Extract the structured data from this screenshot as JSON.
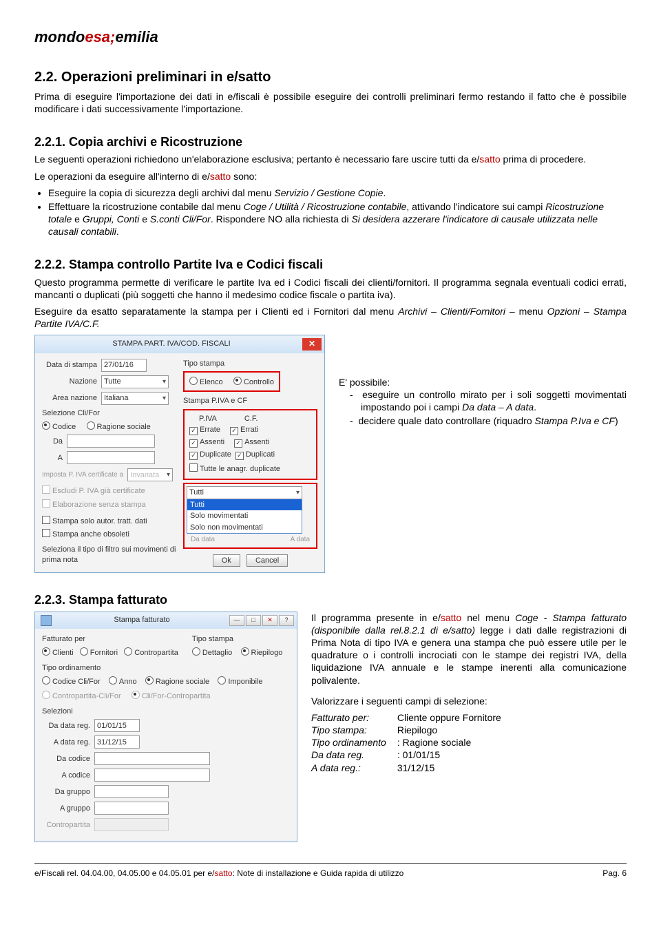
{
  "brand": {
    "part1": "mondo",
    "part2": "esa;",
    "part3": "emilia"
  },
  "s22": {
    "title": "2.2. Operazioni preliminari in e/satto",
    "p1a": "Prima di eseguire l'importazione dei dati in e/fiscali è possibile eseguire dei controlli preliminari fermo restando il fatto che è possibile modificare i dati successivamente l'importazione."
  },
  "s221": {
    "title": "2.2.1. Copia archivi e Ricostruzione",
    "p1a": "Le seguenti operazioni richiedono un'elaborazione esclusiva; pertanto è necessario fare uscire tutti da e/",
    "p1b": "satto",
    "p1c": " prima di procedere.",
    "p2a": "Le operazioni da eseguire all'interno di e/",
    "p2b": "satto",
    "p2c": " sono:",
    "b1a": "Eseguire la copia di sicurezza degli archivi dal menu ",
    "b1b": "Servizio / Gestione Copie",
    "b1c": ".",
    "b2a": "Effettuare la ricostruzione contabile dal menu ",
    "b2b": "Coge / Utilità / Ricostruzione contabile",
    "b2c": ", attivando l'indicatore sui campi ",
    "b2d": "Ricostruzione totale",
    "b2e": " e ",
    "b2f": "Gruppi, Conti",
    "b2g": " e ",
    "b2h": "S.conti Cli/For",
    "b2i": ". Rispondere NO alla richiesta di ",
    "b2j": "Si desidera azzerare l'indicatore di causale utilizzata nelle causali contabili",
    "b2k": "."
  },
  "s222": {
    "title": "2.2.2. Stampa controllo Partite Iva e Codici fiscali",
    "p1": "Questo programma permette di verificare le partite Iva ed i Codici fiscali dei clienti/fornitori. Il programma segnala eventuali codici errati, mancanti o duplicati (più soggetti che hanno il medesimo codice fiscale o partita iva).",
    "p2a": "Eseguire da esatto separatamente la stampa per i Clienti ed i Fornitori dal menu ",
    "p2b": "Archivi – Clienti/Fornitori –",
    "p2c": " menu ",
    "p2d": "Opzioni – Stampa Partite IVA/C.F.",
    "side_title": "E' possibile:",
    "side1a": "eseguire un controllo mirato per i soli soggetti movimentati impostando poi i campi ",
    "side1b": "Da data – A data",
    "side1c": ".",
    "side2a": "decidere quale dato controllare (riquadro ",
    "side2b": "Stampa P.Iva e CF",
    "side2c": ")"
  },
  "dlg1": {
    "title": "STAMPA PART. IVA/COD. FISCALI",
    "data_di_stampa_lbl": "Data di stampa",
    "data_di_stampa_val": "27/01/16",
    "nazione_lbl": "Nazione",
    "nazione_val": "Tutte",
    "area_lbl": "Area nazione",
    "area_val": "Italiana",
    "sel_clifor_lbl": "Selezione Cli/For",
    "codice": "Codice",
    "ragione": "Ragione sociale",
    "da": "Da",
    "a": "A",
    "imposta_lbl": "Imposta P. IVA certificate a",
    "imposta_val": "Invariata",
    "escludi": "Escludi P. IVA già certificate",
    "elab": "Elaborazione senza stampa",
    "solo_autor": "Stampa solo autor. tratt. dati",
    "anche_obs": "Stampa anche obsoleti",
    "seleziona": "Seleziona il tipo di filtro sui movimenti di prima nota",
    "tipo_stampa_lbl": "Tipo stampa",
    "elenco": "Elenco",
    "controllo": "Controllo",
    "stampa_piva_lbl": "Stampa P.IVA e CF",
    "piva": "P.IVA",
    "cf": "C.F.",
    "errate": "Errate",
    "errati": "Errati",
    "assenti": "Assenti",
    "duplicate": "Duplicate",
    "duplicati": "Duplicati",
    "tutte_anagr": "Tutte le anagr. duplicate",
    "dd_tutti": "Tutti",
    "dd_solo_mov": "Solo movimentati",
    "dd_solo_non": "Solo non movimentati",
    "da_data": "Da data",
    "a_data": "A data",
    "ok": "Ok",
    "cancel": "Cancel"
  },
  "s223": {
    "title": "2.2.3. Stampa fatturato",
    "p1a": "Il programma presente in e/",
    "p1b": "satto",
    "p1c": " nel menu ",
    "p1d": "Coge - Stampa fatturato (disponibile dalla rel.8.2.1 di e/satto)",
    "p1e": " legge i dati dalle registrazioni di Prima Nota di tipo IVA e genera una stampa che può essere utile per le quadrature o i controlli incrociati con le stampe dei registri IVA, della liquidazione IVA annuale e le stampe inerenti alla comunicazione polivalente.",
    "p2": "Valorizzare i seguenti campi di selezione:",
    "kv": [
      {
        "k": "Fatturato per:",
        "v": "Cliente oppure Fornitore"
      },
      {
        "k": "Tipo stampa:",
        "v": "Riepilogo"
      },
      {
        "k": "Tipo ordinamento",
        "v": ": Ragione sociale"
      },
      {
        "k": "Da data reg.",
        "v": ": 01/01/15"
      },
      {
        "k": "A data reg.:",
        "v": "31/12/15"
      }
    ]
  },
  "dlg2": {
    "title": "Stampa fatturato",
    "fatturato_lbl": "Fatturato per",
    "clienti": "Clienti",
    "fornitori": "Fornitori",
    "contropartita": "Contropartita",
    "tipo_stampa_lbl": "Tipo stampa",
    "dettaglio": "Dettaglio",
    "riepilogo": "Riepilogo",
    "tipo_ord_lbl": "Tipo ordinamento",
    "cod_clifor": "Codice Cli/For",
    "anno": "Anno",
    "rag_soc": "Ragione sociale",
    "imponibile": "Imponibile",
    "contr_clifor": "Contropartita-Cli/For",
    "clifor_contr": "Cli/For-Contropartita",
    "selezioni_lbl": "Selezioni",
    "da_data_reg": "Da data reg.",
    "da_data_val": "01/01/15",
    "a_data_reg": "A data reg.",
    "a_data_val": "31/12/15",
    "da_codice": "Da codice",
    "a_codice": "A codice",
    "da_gruppo": "Da gruppo",
    "a_gruppo": "A gruppo",
    "contropartita2": "Contropartita"
  },
  "footer": {
    "left_a": "e/Fiscali rel. 04.04.00, 04.05.00 e 04.05.01 per e/",
    "left_b": "satto",
    "left_c": ": Note di installazione e Guida rapida di utilizzo",
    "right": "Pag. 6"
  }
}
